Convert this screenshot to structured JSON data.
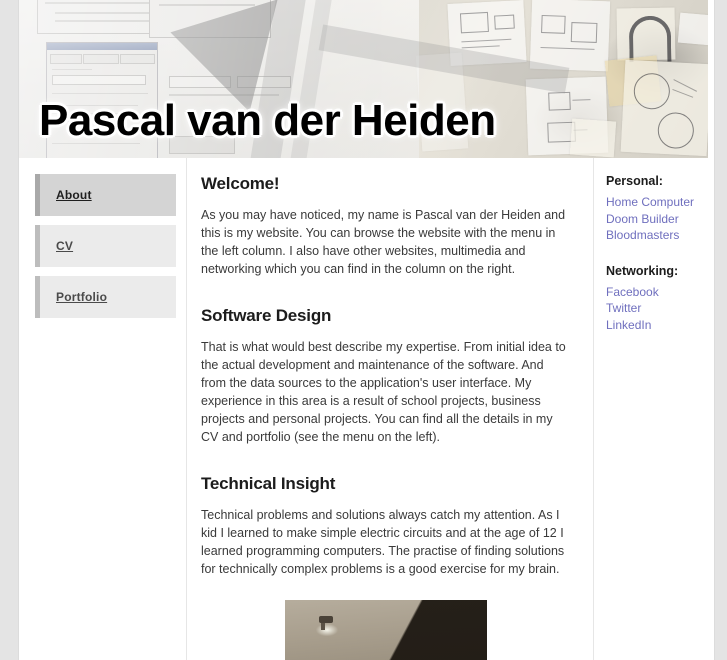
{
  "site": {
    "title": "Pascal van der Heiden"
  },
  "sidebar": {
    "items": [
      {
        "label": "About",
        "active": true
      },
      {
        "label": "CV",
        "active": false
      },
      {
        "label": "Portfolio",
        "active": false
      }
    ]
  },
  "main": {
    "sections": [
      {
        "heading": "Welcome!",
        "body": "As you may have noticed, my name is Pascal van der Heiden and this is my website. You can browse the website with the menu in the left column. I also have other websites, multimedia and networking which you can find in the column on the right."
      },
      {
        "heading": "Software Design",
        "body": "That is what would best describe my expertise. From initial idea to the actual development and maintenance of the software. And from the data sources to the application's user interface. My experience in this area is a result of school projects, business projects and personal projects. You can find all the details in my CV and portfolio (see the menu on the left)."
      },
      {
        "heading": "Technical Insight",
        "body": "Technical problems and solutions always catch my attention. As I kid I learned to make simple electric circuits and at the age of 12 I learned programming computers. The practise of finding solutions for technically complex problems is a good exercise for my brain."
      }
    ]
  },
  "aside": {
    "groups": [
      {
        "heading": "Personal:",
        "links": [
          "Home Computer",
          "Doom Builder",
          "Bloodmasters"
        ]
      },
      {
        "heading": "Networking:",
        "links": [
          "Facebook",
          "Twitter",
          "LinkedIn"
        ]
      }
    ]
  },
  "colors": {
    "page_background": "#e4e4e4",
    "content_background": "#ffffff",
    "nav_item_background": "#ebebeb",
    "nav_item_active_background": "#d4d4d4",
    "nav_accent_border": "#bdbdbd",
    "link": "#6f6fbe",
    "heading_text": "#1c1c1c",
    "body_text": "#3a3a3a"
  }
}
